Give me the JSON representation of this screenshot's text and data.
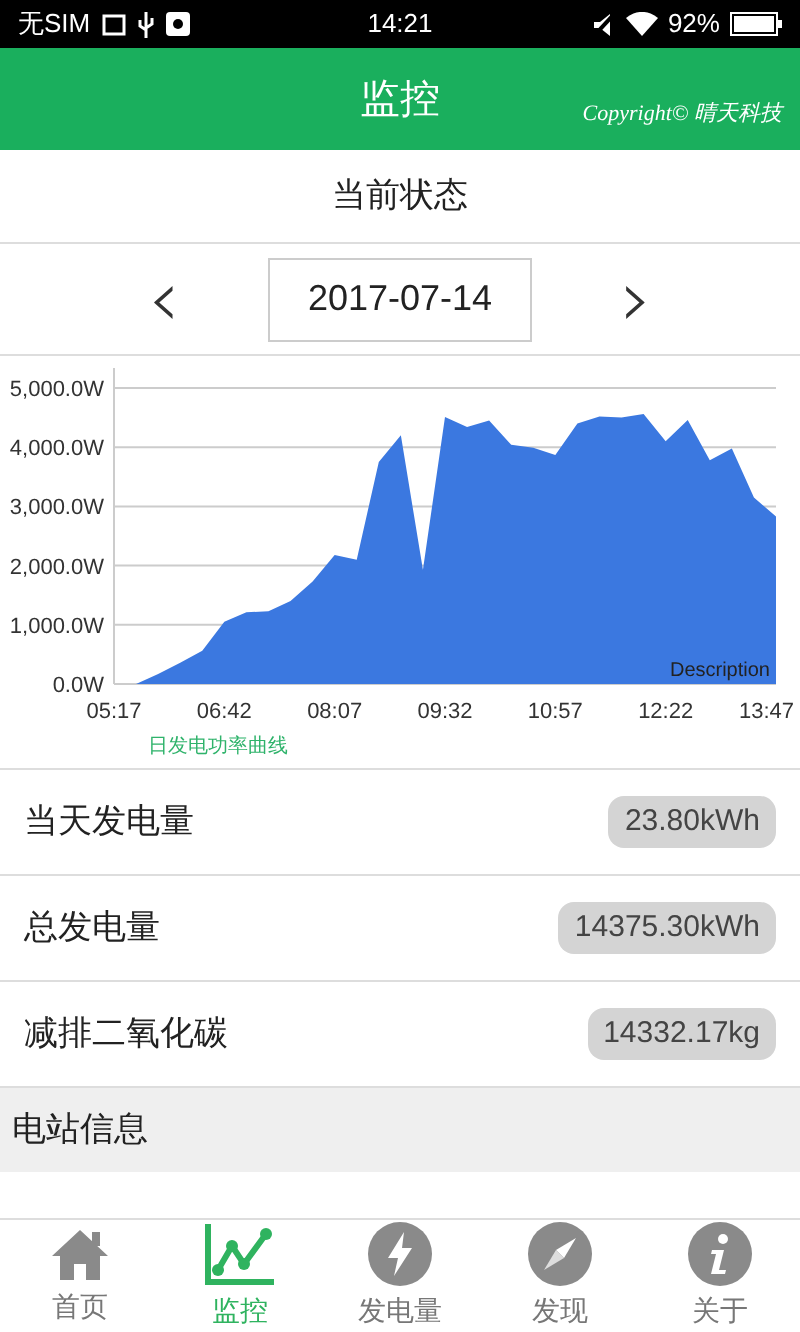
{
  "status_bar": {
    "carrier": "无SIM",
    "time": "14:21",
    "battery": "92%"
  },
  "header": {
    "title": "监控",
    "copyright": "Copyright© 晴天科技"
  },
  "section_title": "当前状态",
  "date_picker": {
    "prev": "‹",
    "date": "2017-07-14",
    "next": "›"
  },
  "chart_data": {
    "type": "area",
    "grid": true,
    "annotations": [
      {
        "text": "Description"
      }
    ],
    "ylim": [
      0,
      5000
    ],
    "yticks": [
      {
        "value": 0,
        "label": "0.0W"
      },
      {
        "value": 1000,
        "label": "1,000.0W"
      },
      {
        "value": 2000,
        "label": "2,000.0W"
      },
      {
        "value": 3000,
        "label": "3,000.0W"
      },
      {
        "value": 4000,
        "label": "4,000.0W"
      },
      {
        "value": 5000,
        "label": "5,000.0W"
      }
    ],
    "categories": [
      "05:17",
      null,
      null,
      null,
      null,
      "06:42",
      null,
      null,
      null,
      null,
      "08:07",
      null,
      null,
      null,
      null,
      "09:32",
      null,
      null,
      null,
      null,
      "10:57",
      null,
      null,
      null,
      null,
      "12:22",
      null,
      null,
      null,
      null,
      "13:47"
    ],
    "series": [
      {
        "name": "日发电功率曲线",
        "color": "#3b78e0",
        "values": [
          0,
          0,
          170,
          360,
          560,
          1050,
          1210,
          1230,
          1400,
          1730,
          2180,
          2100,
          3750,
          4200,
          1930,
          4510,
          4340,
          4450,
          4040,
          3990,
          3870,
          4400,
          4520,
          4500,
          4560,
          4100,
          4460,
          3780,
          3980,
          3150,
          2830
        ]
      }
    ]
  },
  "stats": [
    {
      "label": "当天发电量",
      "value": "23.80kWh"
    },
    {
      "label": "总发电量",
      "value": "14375.30kWh"
    },
    {
      "label": "减排二氧化碳",
      "value": "14332.17kg"
    }
  ],
  "station_section": "电站信息",
  "tabs": [
    {
      "label": "首页",
      "selected": false
    },
    {
      "label": "监控",
      "selected": true
    },
    {
      "label": "发电量",
      "selected": false
    },
    {
      "label": "发现",
      "selected": false
    },
    {
      "label": "关于",
      "selected": false
    }
  ]
}
